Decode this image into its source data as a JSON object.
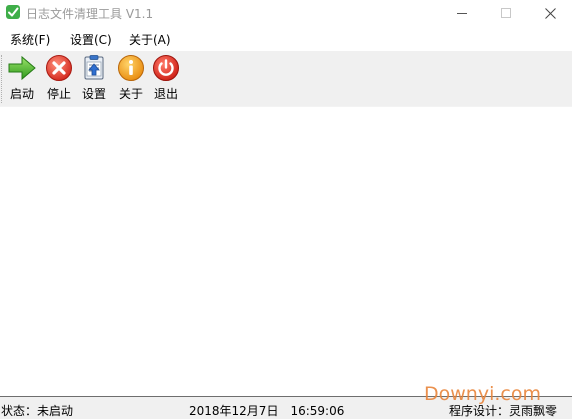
{
  "window": {
    "title": "日志文件清理工具 V1.1",
    "app_icon": "check-leaf-icon",
    "controls": [
      "minimize-icon",
      "maximize-icon",
      "close-icon"
    ]
  },
  "menu": {
    "items": [
      {
        "label": "系统(F)"
      },
      {
        "label": "设置(C)"
      },
      {
        "label": "关于(A)"
      }
    ]
  },
  "toolbar": {
    "buttons": [
      {
        "label": "启动",
        "icon": "green-arrow-right-icon"
      },
      {
        "label": "停止",
        "icon": "red-x-icon"
      },
      {
        "label": "设置",
        "icon": "clipboard-settings-icon"
      },
      {
        "label": "关于",
        "icon": "info-icon"
      },
      {
        "label": "退出",
        "icon": "power-icon"
      }
    ]
  },
  "statusbar": {
    "status": "状态：未启动",
    "datetime": "2018年12月7日　16:59:06",
    "author": "程序设计：灵雨飘零"
  },
  "watermark": "Downyi.com",
  "colors": {
    "toolbar_bg": "#f0f0f0",
    "statusbar_bg": "#f0f0f0",
    "title_text": "#9a9a9a",
    "watermark": "#e8843a"
  }
}
